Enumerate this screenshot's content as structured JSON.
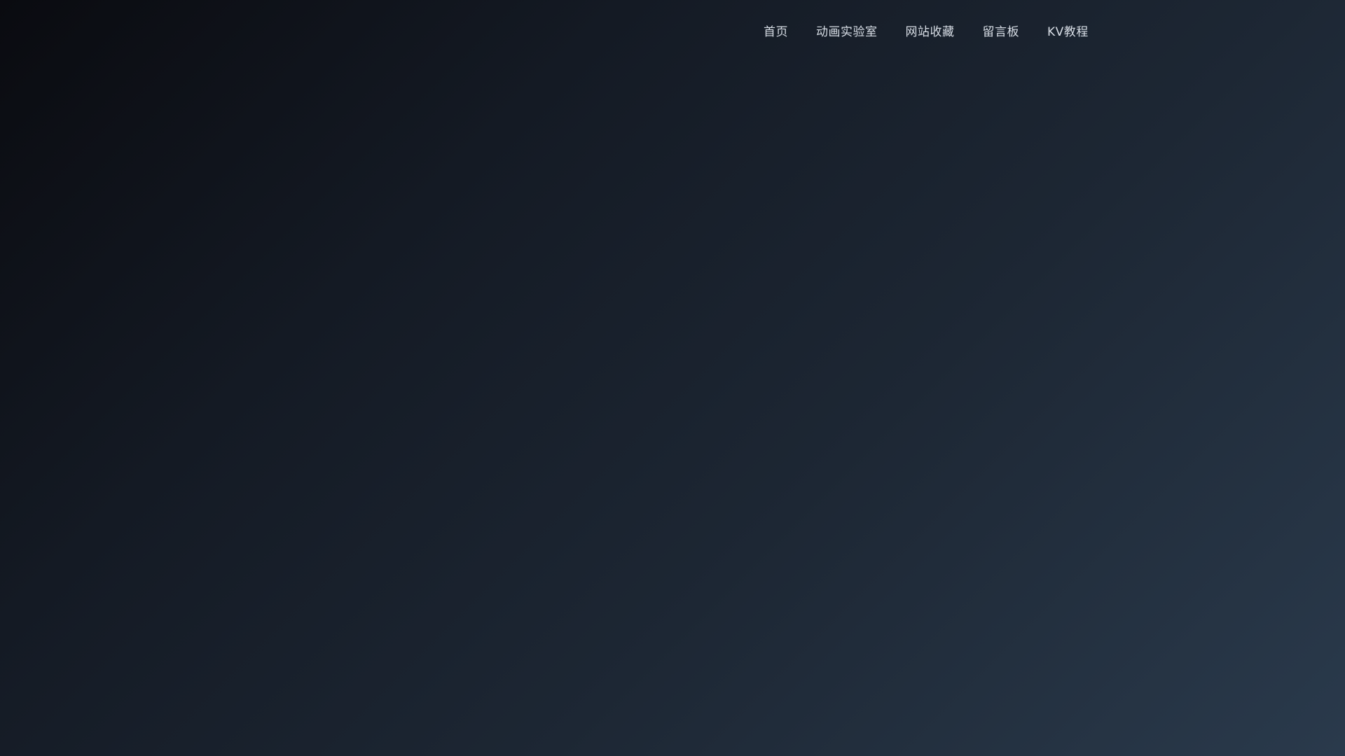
{
  "nav": {
    "items": [
      {
        "label": "首页"
      },
      {
        "label": "动画实验室"
      },
      {
        "label": "网站收藏"
      },
      {
        "label": "留言板"
      },
      {
        "label": "KV教程"
      }
    ]
  },
  "theme": {
    "background_start": "#0a0b10",
    "background_end": "#2a3a4c",
    "nav_text": "#d8dee6"
  }
}
